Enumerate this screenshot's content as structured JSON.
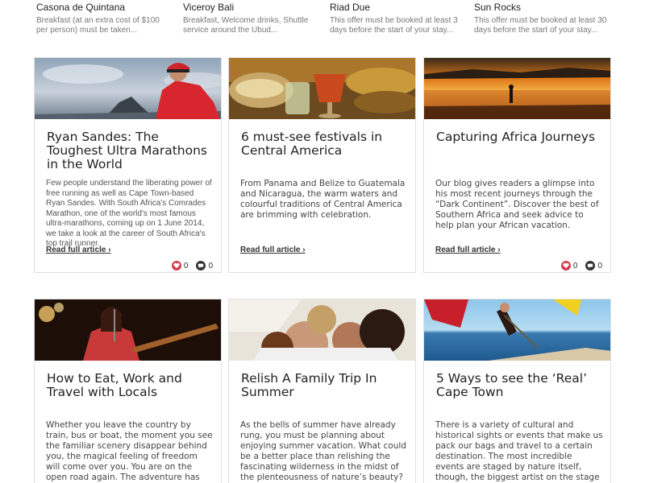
{
  "offers": [
    {
      "title": "Casona de Quintana",
      "desc": "Breakfast (at an extra cost of $100 per person) must be taken..."
    },
    {
      "title": "Viceroy Bali",
      "desc": "Breakfast, Welcome drinks, Shuttle service around the Ubud..."
    },
    {
      "title": "Riad Due",
      "desc": "This offer must be booked at least 3 days before the start of your stay..."
    },
    {
      "title": "Sun Rocks",
      "desc": "This offer must be booked at least 30 days before the start of your stay..."
    }
  ],
  "cards": [
    {
      "title": "Ryan Sandes: The Toughest Ultra Marathons in the World",
      "excerpt": "Few people understand the liberating power of free running as well as Cape Town-based Ryan Sandes. With South Africa's Comrades Marathon, one of the world's most famous ultra-marathons, coming up on 1 June 2014, we take a look at the career of South Africa's top trail runner.",
      "read_more": "Read full article ›",
      "likes": "0",
      "comments": "0"
    },
    {
      "title": "6 must-see festivals in Central America",
      "excerpt": "From Panama and Belize to Guatemala and Nicaragua, the warm waters and colourful traditions of Central America are brimming with celebration.",
      "read_more": "Read full article ›"
    },
    {
      "title": "Capturing Africa Journeys",
      "excerpt": "Our blog gives readers a glimpse into his most recent journeys through the “Dark Continent”. Discover the best of Southern Africa and seek advice to help plan your African vacation.",
      "read_more": "Read full article ›",
      "likes": "0",
      "comments": "0"
    },
    {
      "title": "How to Eat, Work and Travel with Locals",
      "excerpt": "Whether you leave the country by train, bus or boat, the moment you see the familiar scenery disappear behind you, the magical feeling of freedom will come over you. You are on the open road again. The adventure has begun."
    },
    {
      "title": "Relish A Family Trip In Summer",
      "excerpt": "As the bells of summer have already rung, you must be planning about enjoying summer vacation. What could be a better place than relishing the fascinating wilderness in the midst of the plenteousness of nature’s beauty?"
    },
    {
      "title": "5 Ways to see the ‘Real’ Cape Town",
      "excerpt": "There is a variety of cultural and historical sights or events that make us pack our bags and travel to a certain destination. The most incredible events are staged by nature itself, though, the biggest artist on the stage of planet earth"
    }
  ]
}
